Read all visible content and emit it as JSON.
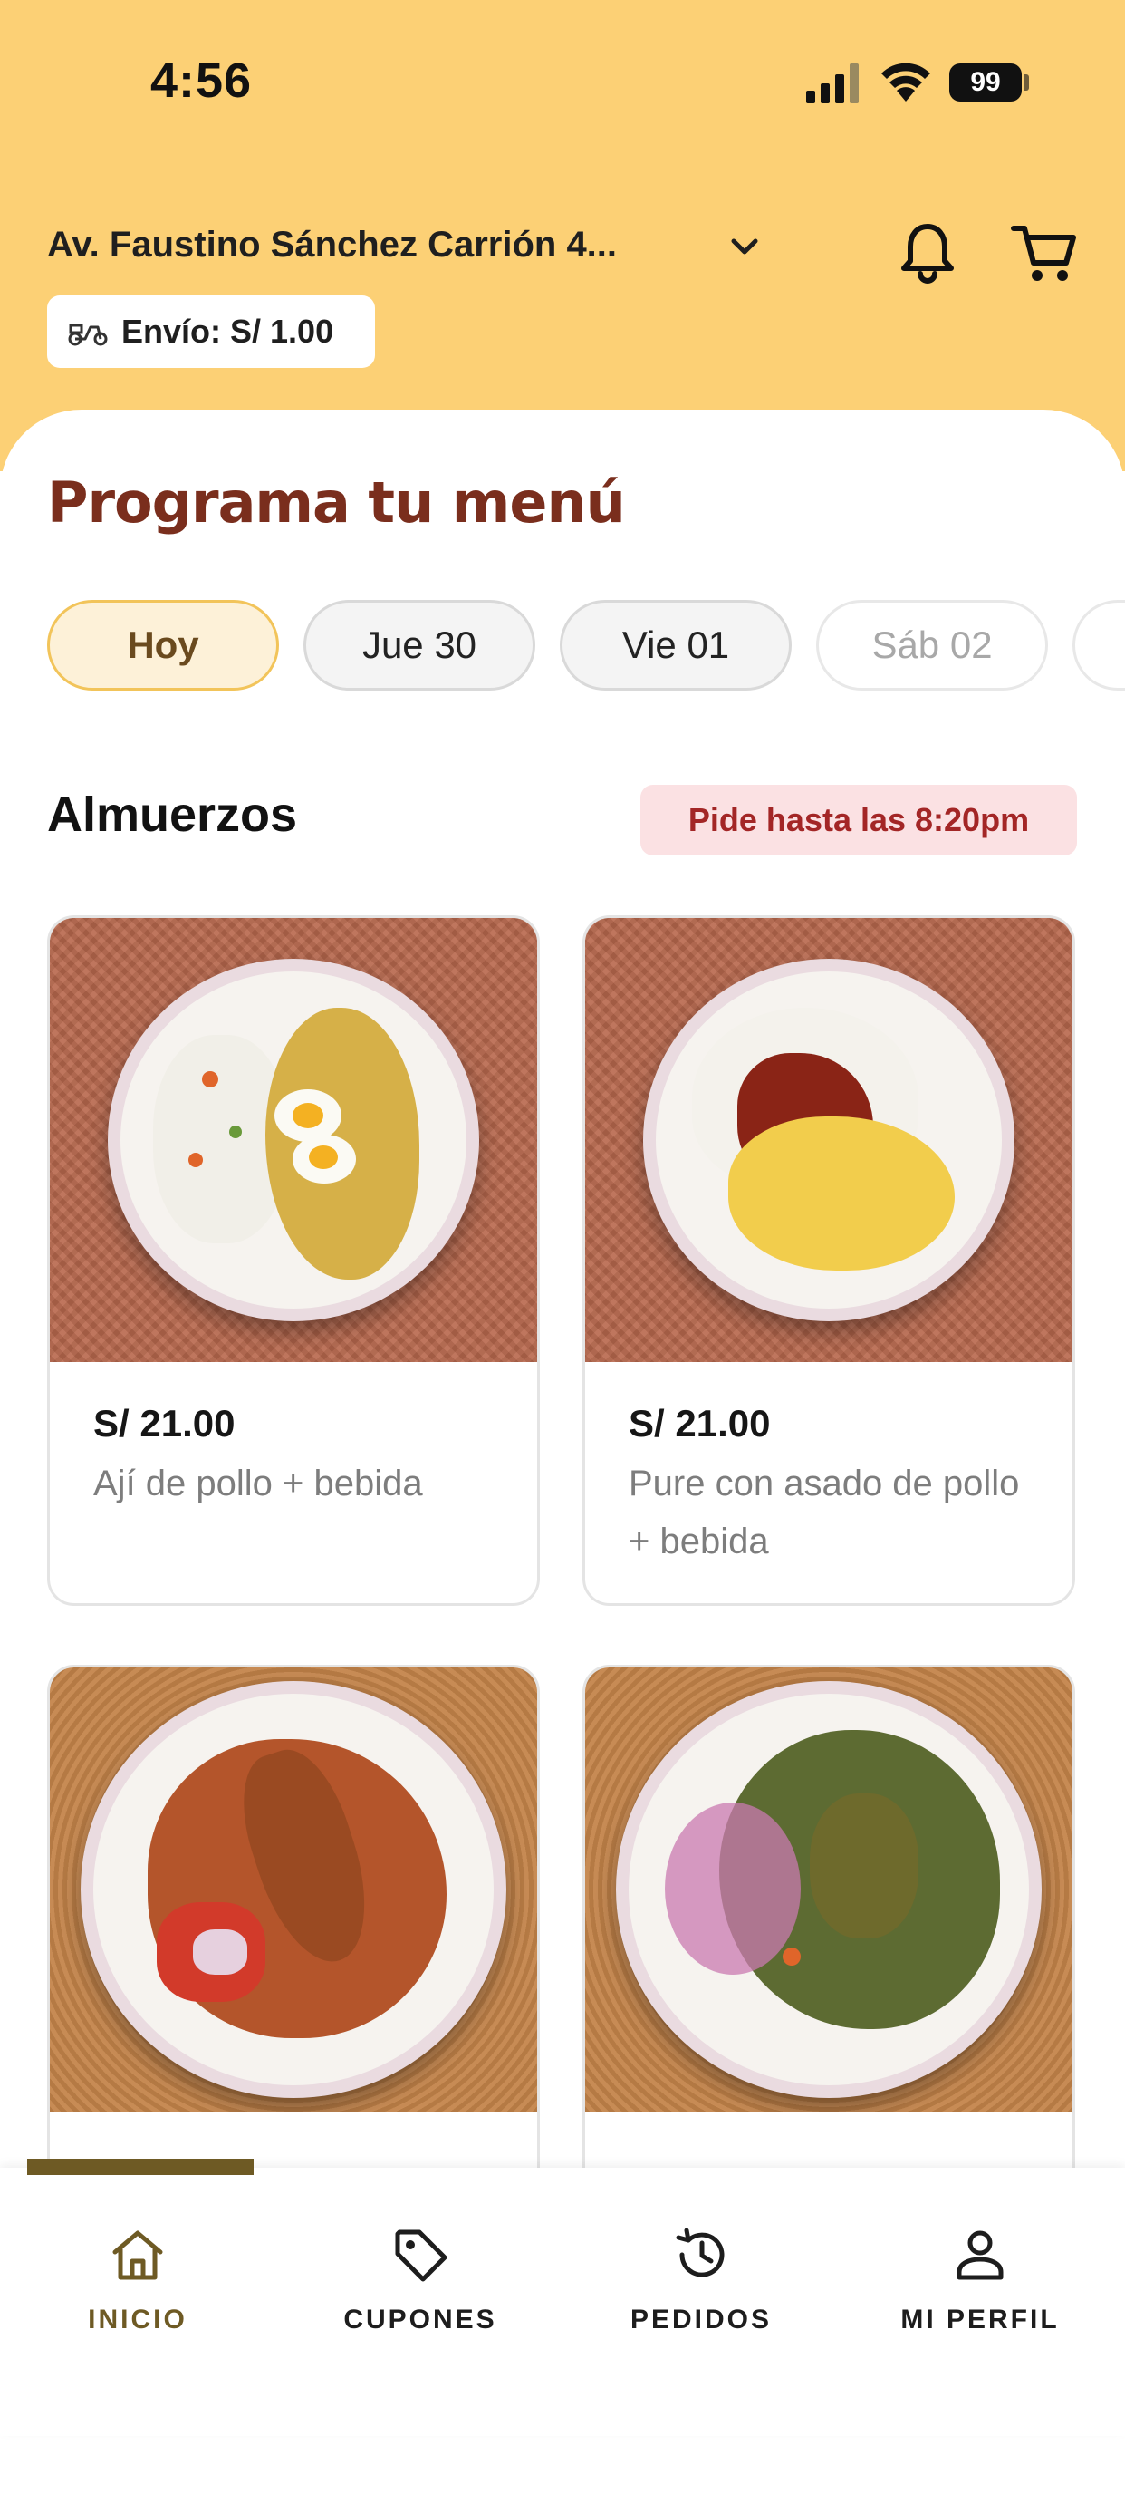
{
  "status_bar": {
    "time": "4:56",
    "battery": "99"
  },
  "header": {
    "address": "Av. Faustino Sánchez Carrión 4...",
    "delivery_fee": "Envío: S/ 1.00"
  },
  "page": {
    "title": "Programa tu menú"
  },
  "days": [
    {
      "label": "Hoy",
      "state": "active"
    },
    {
      "label": "Jue 30",
      "state": "normal"
    },
    {
      "label": "Vie 01",
      "state": "normal"
    },
    {
      "label": "Sáb 02",
      "state": "disabled"
    }
  ],
  "section": {
    "title": "Almuerzos",
    "deadline": "Pide hasta las 8:20pm"
  },
  "products": [
    {
      "price": "S/ 21.00",
      "name": "Ají de pollo + bebida"
    },
    {
      "price": "S/ 21.00",
      "name": "Pure con asado de pollo + bebida"
    },
    {
      "price": "",
      "name": ""
    },
    {
      "price": "",
      "name": ""
    }
  ],
  "bottom_nav": [
    {
      "label": "INICIO",
      "icon": "home-icon",
      "active": true
    },
    {
      "label": "CUPONES",
      "icon": "tag-icon",
      "active": false
    },
    {
      "label": "PEDIDOS",
      "icon": "history-icon",
      "active": false
    },
    {
      "label": "MI PERFIL",
      "icon": "person-icon",
      "active": false
    }
  ],
  "colors": {
    "header_background": "#fcd075",
    "title_color": "#7a2e1d",
    "active_nav": "#6e5a24",
    "deadline_background": "#fbe1e3",
    "deadline_text": "#a32626"
  }
}
